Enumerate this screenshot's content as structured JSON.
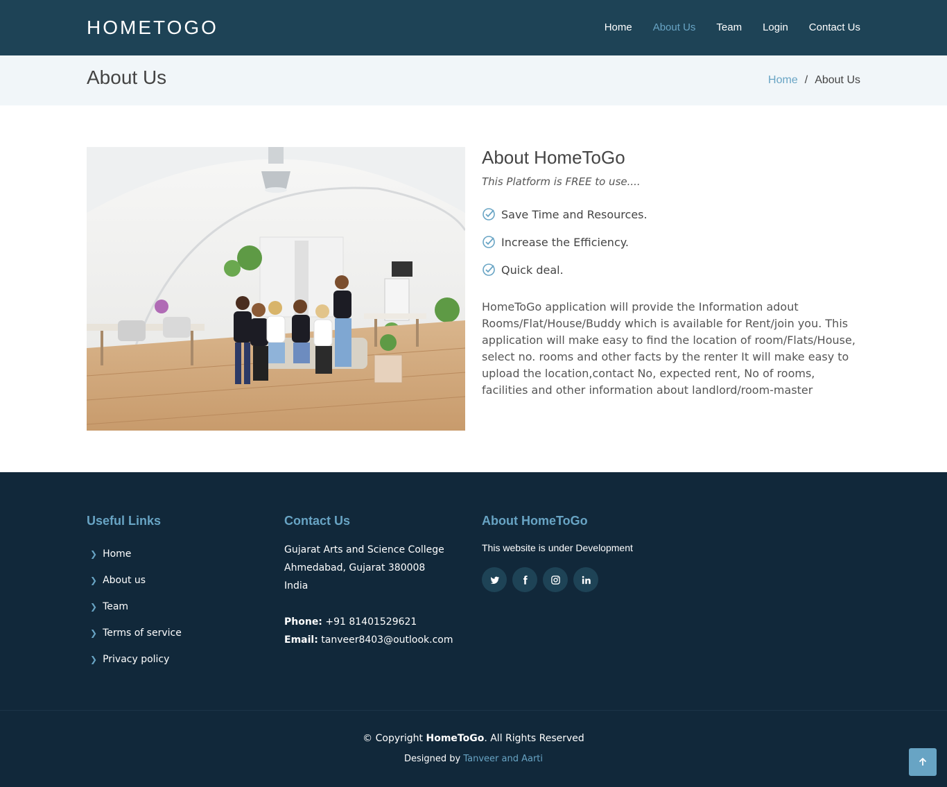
{
  "header": {
    "logo": "HOMETOGO",
    "nav": [
      "Home",
      "About Us",
      "Team",
      "Login",
      "Contact Us"
    ],
    "active_nav": "About Us"
  },
  "breadcrumb": {
    "title": "About Us",
    "home": "Home",
    "separator": "/",
    "current": "About Us"
  },
  "about": {
    "heading": "About HomeToGo",
    "tagline": "This Platform is FREE to use....",
    "points": [
      "Save Time and Resources.",
      "Increase the Efficiency.",
      "Quick deal."
    ],
    "description": "HomeToGo application will provide the Information adout Rooms/Flat/House/Buddy which is available for Rent/join you. This application will make easy to find the location of room/Flats/House, select no. rooms and other facts by the renter It will make easy to upload the location,contact No, expected rent, No of rooms, facilities and other information about landlord/room-master"
  },
  "footer": {
    "links_title": "Useful Links",
    "links": [
      "Home",
      "About us",
      "Team",
      "Terms of service",
      "Privacy policy"
    ],
    "contact_title": "Contact Us",
    "address": [
      "Gujarat Arts and Science College",
      "Ahmedabad, Gujarat 380008",
      "India"
    ],
    "phone_label": "Phone:",
    "phone": "+91 81401529621",
    "email_label": "Email:",
    "email": "tanveer8403@outlook.com",
    "about_title": "About HomeToGo",
    "about_text": "This website is under Development",
    "socials": [
      "twitter-icon",
      "facebook-icon",
      "instagram-icon",
      "linkedin-icon"
    ],
    "copyright_prefix": "© Copyright",
    "copyright_brand": "HomeToGo",
    "copyright_suffix": ". All Rights Reserved",
    "designed_prefix": "Designed by",
    "designed_by": "Tanveer and Aarti"
  },
  "colors": {
    "header_bg": "#1e4356",
    "accent": "#68a4c4",
    "footer_bg": "#11283a"
  }
}
